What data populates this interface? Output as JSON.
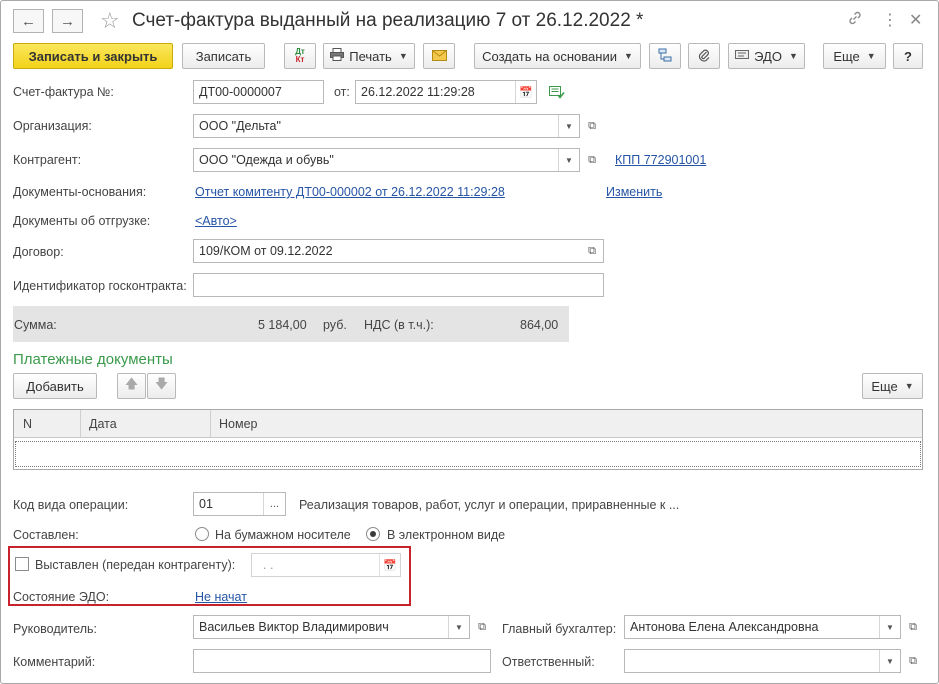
{
  "window": {
    "title": "Счет-фактура выданный на реализацию 7 от 26.12.2022 *"
  },
  "toolbar": {
    "save_close": "Записать и закрыть",
    "save": "Записать",
    "print": "Печать",
    "create_based": "Создать на основании",
    "edo": "ЭДО",
    "more": "Еще",
    "help": "?"
  },
  "header": {
    "invoice_no_label": "Счет-фактура №:",
    "invoice_no": "ДТ00-0000007",
    "date_label": "от:",
    "date": "26.12.2022 11:29:28"
  },
  "organization": {
    "label": "Организация:",
    "value": "ООО \"Дельта\""
  },
  "counterparty": {
    "label": "Контрагент:",
    "value": "ООО \"Одежда и обувь\"",
    "kpp": "КПП 772901001"
  },
  "base_docs": {
    "label": "Документы-основания:",
    "value": "Отчет комитенту ДТ00-000002 от 26.12.2022 11:29:28",
    "change": "Изменить"
  },
  "shipment_docs": {
    "label": "Документы об отгрузке:",
    "value": "<Авто>"
  },
  "contract": {
    "label": "Договор:",
    "value": "109/КОМ от 09.12.2022"
  },
  "gov_contract": {
    "label": "Идентификатор госконтракта:",
    "value": ""
  },
  "totals": {
    "sum_label": "Сумма:",
    "sum": "5 184,00",
    "currency": "руб.",
    "vat_label": "НДС (в т.ч.):",
    "vat": "864,00"
  },
  "payment_docs": {
    "title": "Платежные документы",
    "add": "Добавить",
    "more": "Еще",
    "columns": [
      "N",
      "Дата",
      "Номер"
    ]
  },
  "operation_code": {
    "label": "Код вида операции:",
    "value": "01",
    "button": "...",
    "description": "Реализация товаров, работ, услуг и операции, приравненные к ..."
  },
  "composed": {
    "label": "Составлен:",
    "paper": "На бумажном носителе",
    "electronic": "В электронном виде",
    "selected": "electronic"
  },
  "issued": {
    "label": "Выставлен (передан контрагенту):",
    "checked": false,
    "date": ".  ."
  },
  "edo_state": {
    "label": "Состояние ЭДО:",
    "value": "Не начат"
  },
  "manager": {
    "label": "Руководитель:",
    "value": "Васильев Виктор Владимирович"
  },
  "chief_accountant": {
    "label": "Главный бухгалтер:",
    "value": "Антонова Елена Александровна"
  },
  "comment": {
    "label": "Комментарий:",
    "value": ""
  },
  "responsible": {
    "label": "Ответственный:",
    "value": ""
  },
  "colors": {
    "primary_button": "#f2d21a",
    "link": "#2655a6",
    "section_title": "#3b9a4b",
    "highlight_border": "#c8232b"
  }
}
